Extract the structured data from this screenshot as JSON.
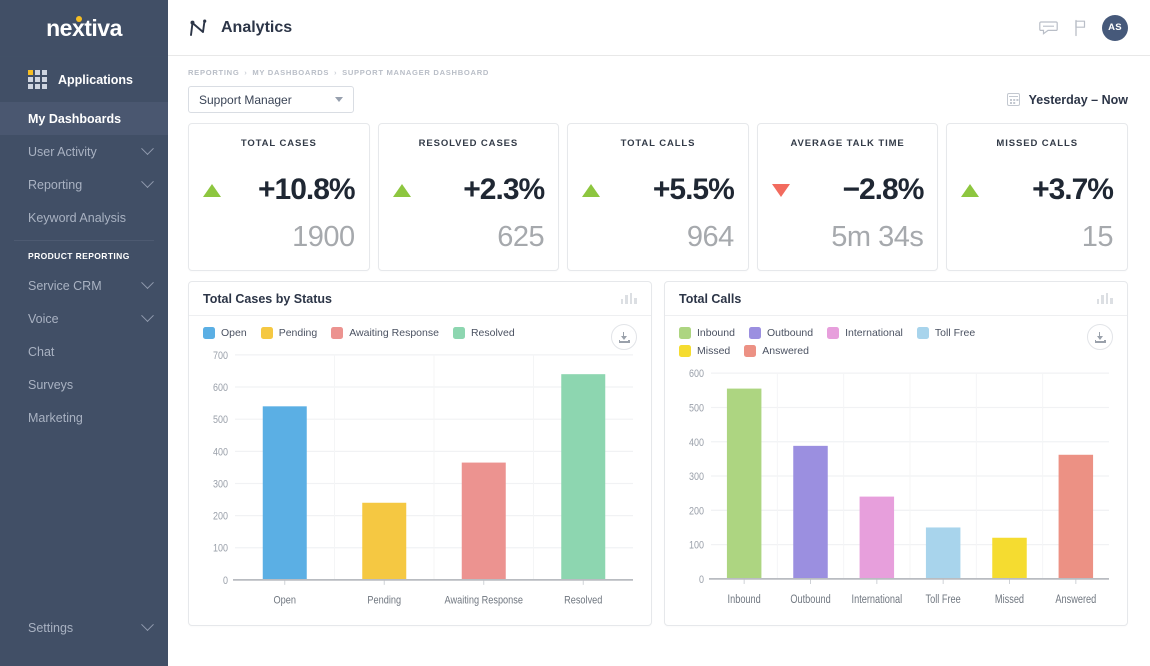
{
  "sidebar": {
    "logo": "nextiva",
    "applications_label": "Applications",
    "items": [
      {
        "label": "My Dashboards",
        "active": true,
        "chevron": false
      },
      {
        "label": "User Activity",
        "active": false,
        "chevron": true
      },
      {
        "label": "Reporting",
        "active": false,
        "chevron": true
      },
      {
        "label": "Keyword Analysis",
        "active": false,
        "chevron": false
      }
    ],
    "section_label": "PRODUCT REPORTING",
    "product_items": [
      {
        "label": "Service CRM",
        "chevron": true
      },
      {
        "label": "Voice",
        "chevron": true
      },
      {
        "label": "Chat",
        "chevron": false
      },
      {
        "label": "Surveys",
        "chevron": false
      },
      {
        "label": "Marketing",
        "chevron": false
      }
    ],
    "settings": {
      "label": "Settings",
      "chevron": true
    },
    "bg_color": "#414F66",
    "active_color": "#4A5770"
  },
  "header": {
    "title": "Analytics",
    "logo_icon": "analytics-n-icon",
    "icons": [
      {
        "name": "chat-bubble-icon"
      },
      {
        "name": "flag-icon"
      }
    ],
    "avatar_initials": "AS"
  },
  "breadcrumb": {
    "items": [
      "REPORTING",
      "MY DASHBOARDS",
      "SUPPORT MANAGER DASHBOARD"
    ],
    "separator": "›"
  },
  "toolbar": {
    "dashboard_select_value": "Support Manager",
    "date_range": "Yesterday – Now",
    "calendar_icon": "calendar-icon"
  },
  "kpis": [
    {
      "title": "TOTAL CASES",
      "delta": "+10.8%",
      "direction": "up",
      "value": "1900"
    },
    {
      "title": "RESOLVED CASES",
      "delta": "+2.3%",
      "direction": "up",
      "value": "625"
    },
    {
      "title": "TOTAL CALLS",
      "delta": "+5.5%",
      "direction": "up",
      "value": "964"
    },
    {
      "title": "AVERAGE TALK TIME",
      "delta": "−2.8%",
      "direction": "down",
      "value": "5m 34s"
    },
    {
      "title": "MISSED CALLS",
      "delta": "+3.7%",
      "direction": "up",
      "value": "15"
    }
  ],
  "colors": {
    "up_green": "#8DC63F",
    "down_red": "#F26B5E",
    "sidebar": "#414F66",
    "accent_yellow": "#F6BE23"
  },
  "chart_data": [
    {
      "type": "bar",
      "title": "Total Cases by Status",
      "card_icon": "bar-chart-icon",
      "download_label": "download-icon",
      "categories": [
        "Open",
        "Pending",
        "Awaiting Response",
        "Resolved"
      ],
      "values": [
        540,
        240,
        365,
        640
      ],
      "colors": [
        "#5BAFE4",
        "#F5C842",
        "#EC9390",
        "#8DD6B0"
      ],
      "legend": [
        "Open",
        "Pending",
        "Awaiting Response",
        "Resolved"
      ],
      "legend_position": "top",
      "yticks": [
        0,
        100,
        200,
        300,
        400,
        500,
        600,
        700
      ],
      "ylim": [
        0,
        700
      ],
      "xlabel": "",
      "ylabel": "",
      "grid": true
    },
    {
      "type": "bar",
      "title": "Total Calls",
      "card_icon": "bar-chart-icon",
      "download_label": "download-icon",
      "categories": [
        "Inbound",
        "Outbound",
        "International",
        "Toll Free",
        "Missed",
        "Answered"
      ],
      "values": [
        555,
        388,
        240,
        150,
        120,
        362
      ],
      "colors": [
        "#ADD581",
        "#9B8FE0",
        "#E79FDC",
        "#A8D4EC",
        "#F5DC30",
        "#EC9184"
      ],
      "legend": [
        "Inbound",
        "Outbound",
        "International",
        "Toll Free",
        "Missed",
        "Answered"
      ],
      "legend_position": "top",
      "yticks": [
        0,
        100,
        200,
        300,
        400,
        500,
        600
      ],
      "ylim": [
        0,
        600
      ],
      "xlabel": "",
      "ylabel": "",
      "grid": true
    }
  ]
}
